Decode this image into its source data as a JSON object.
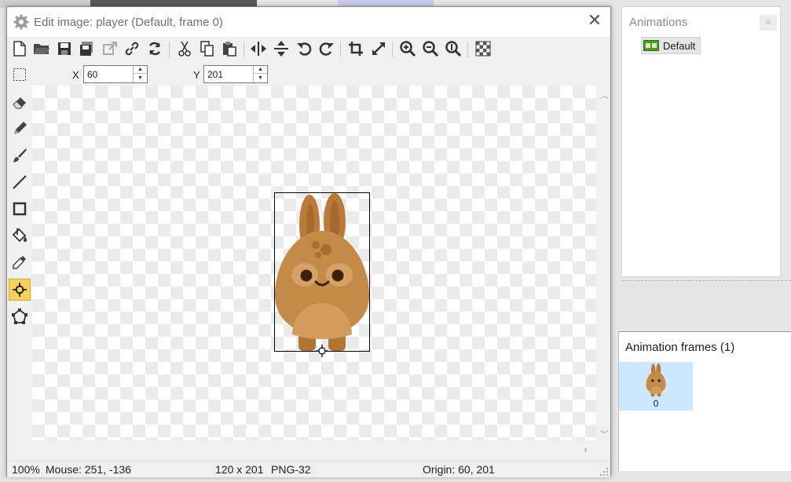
{
  "dialog": {
    "title": "Edit image: player (Default, frame 0)",
    "close_glyph": "✕"
  },
  "toolbar": {
    "buttons": [
      "new-icon",
      "open-icon",
      "save-icon",
      "save-as-icon",
      "export-icon",
      "link-icon",
      "refresh-icon",
      "cut-icon",
      "copy-icon",
      "paste-icon",
      "flip-horizontal-icon",
      "flip-vertical-icon",
      "rotate-left-icon",
      "rotate-right-icon",
      "crop-icon",
      "resize-icon",
      "zoom-in-icon",
      "zoom-out-icon",
      "zoom-actual-icon",
      "transparency-icon"
    ]
  },
  "coords": {
    "x_label": "X",
    "x_value": "60",
    "y_label": "Y",
    "y_value": "201"
  },
  "tools": [
    "select-icon",
    "eraser-icon",
    "pencil-icon",
    "brush-icon",
    "line-icon",
    "rectangle-icon",
    "fill-icon",
    "eyedropper-icon",
    "origin-icon",
    "collision-mask-icon"
  ],
  "active_tool": "origin-icon",
  "status": {
    "zoom": "100%",
    "mouse": "Mouse: 251, -136",
    "size": "120 x 201",
    "format": "PNG-32",
    "origin": "Origin: 60, 201"
  },
  "animations": {
    "header": "Animations",
    "pin_glyph": "✕",
    "items": [
      {
        "label": "Default"
      }
    ]
  },
  "frames": {
    "header": "Animation frames (1)",
    "items": [
      {
        "label": "0"
      }
    ]
  },
  "colors": {
    "accent_active": "#f7d15c",
    "selection": "#cce8ff",
    "sprite_body": "#c48a48"
  }
}
